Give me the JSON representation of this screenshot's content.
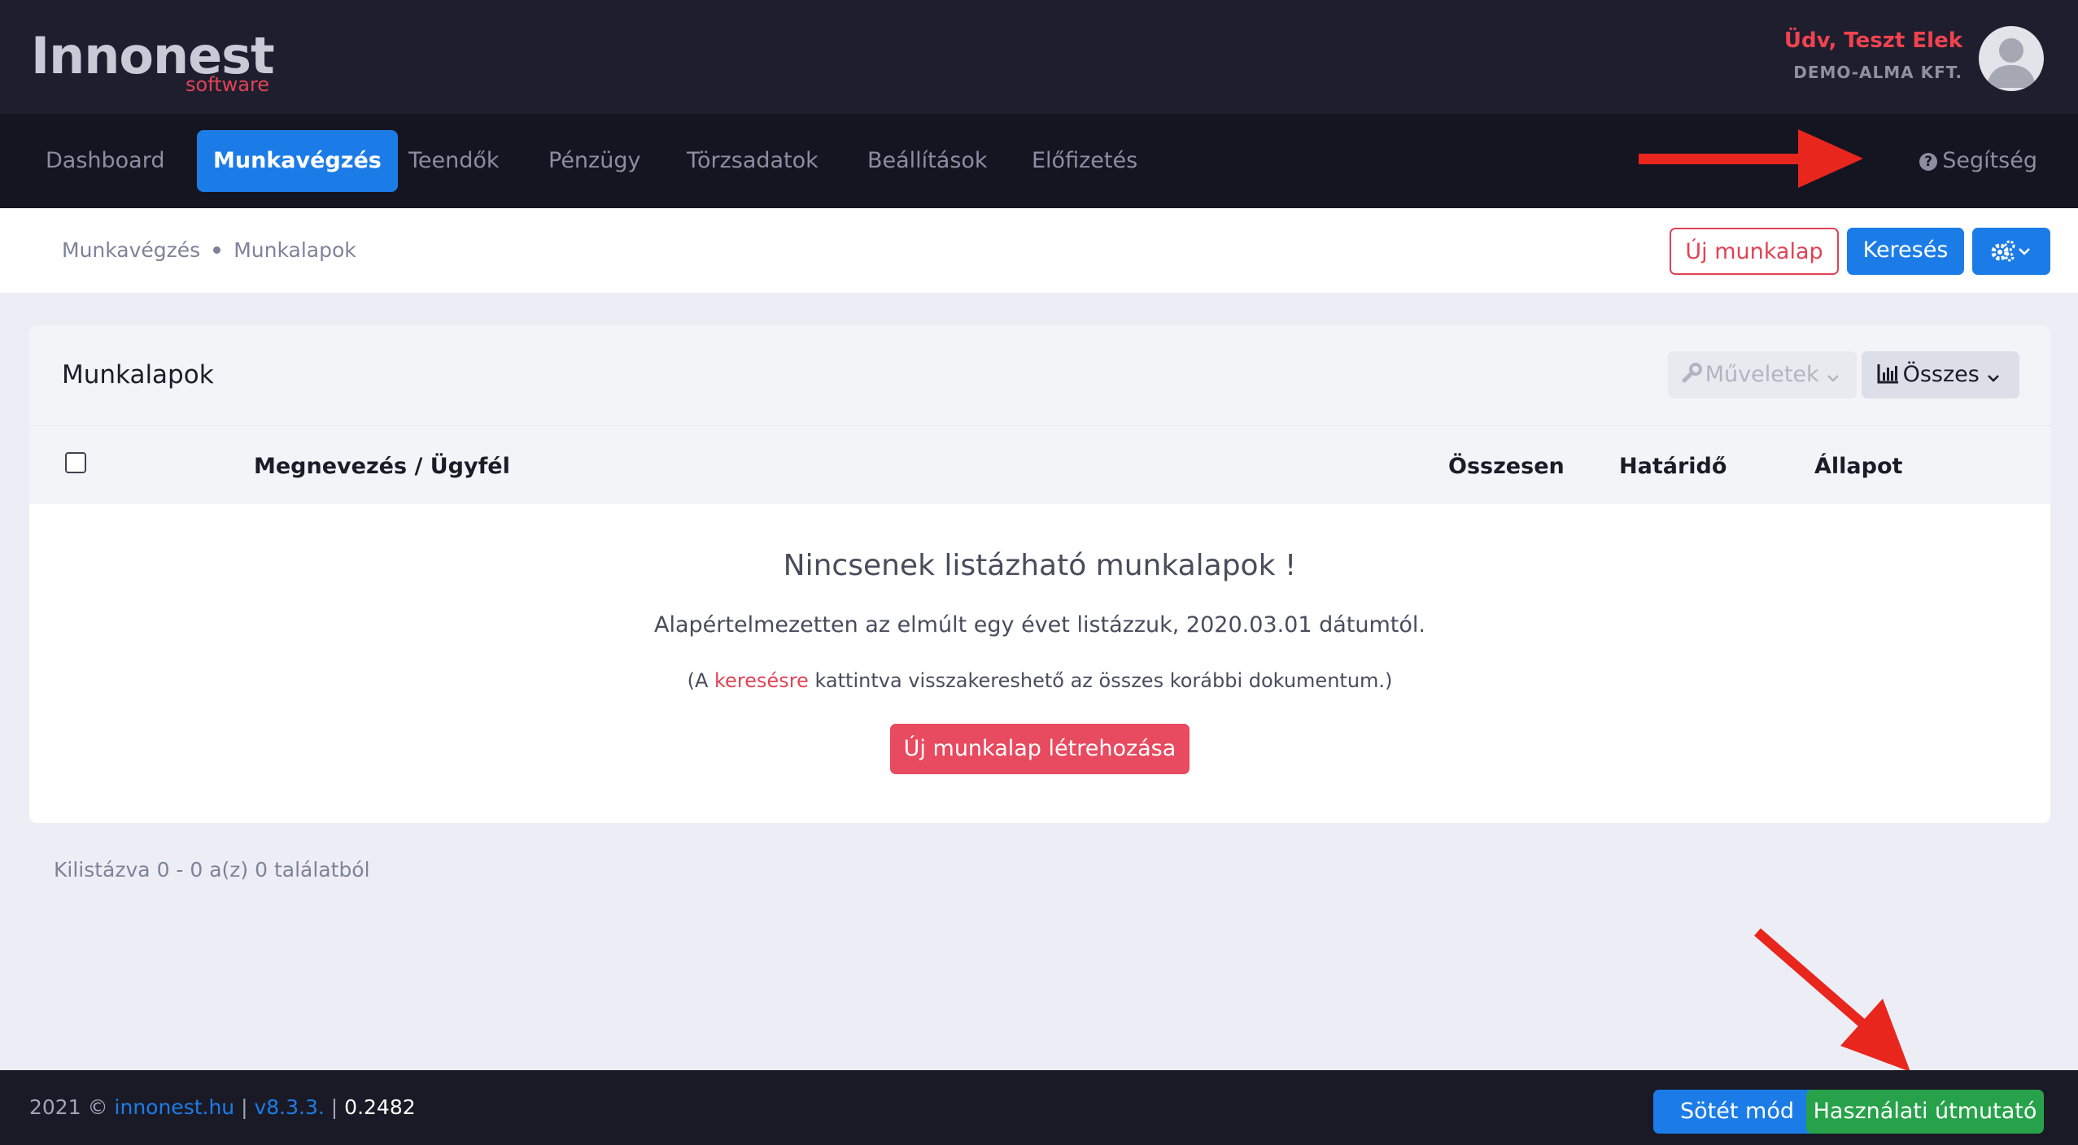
{
  "brand": {
    "name": "Innonest",
    "sub": "software"
  },
  "user": {
    "greeting": "Üdv, Teszt Elek",
    "company": "DEMO-ALMA KFT."
  },
  "nav": {
    "items": [
      {
        "label": "Dashboard"
      },
      {
        "label": "Munkavégzés",
        "active": true
      },
      {
        "label": "Teendők"
      },
      {
        "label": "Pénzügy"
      },
      {
        "label": "Törzsadatok"
      },
      {
        "label": "Beállítások"
      },
      {
        "label": "Előfizetés"
      }
    ],
    "help_label": "Segítség",
    "help_icon": "question-circle-icon"
  },
  "breadcrumb": {
    "parent": "Munkavégzés",
    "current": "Munkalapok"
  },
  "toolbar": {
    "new_label": "Új munkalap",
    "search_label": "Keresés",
    "settings_icon": "gears-icon"
  },
  "card": {
    "title": "Munkalapok",
    "operations_label": "Műveletek",
    "filter_label": "Összes",
    "columns": [
      "Megnevezés / Ügyfél",
      "Összesen",
      "Határidő",
      "Állapot"
    ],
    "empty": {
      "title": "Nincsenek listázható munkalapok !",
      "description": "Alapértelmezetten az elmúlt egy évet listázzuk, 2020.03.01 dátumtól.",
      "hint_prefix": "(A ",
      "hint_link": "keresésre",
      "hint_suffix": " kattintva visszakereshető az összes korábbi dokumentum.)",
      "create_label": "Új munkalap létrehozása"
    }
  },
  "pagination": {
    "summary": "Kilistázva 0 - 0 a(z) 0 találatból"
  },
  "footer": {
    "copyright": "2021 © ",
    "site_link": "innonest.hu",
    "sep1": " | ",
    "version_link": "v8.3.3.",
    "sep2": " | ",
    "build": "0.2482",
    "dark_mode_label": "Sötét mód",
    "guide_label": "Használati útmutató"
  },
  "colors": {
    "primary": "#1c7ce7",
    "danger": "#e04356",
    "success": "#27a24a",
    "dark": "#1f1e2e",
    "annotation_arrow": "#e8261d"
  }
}
